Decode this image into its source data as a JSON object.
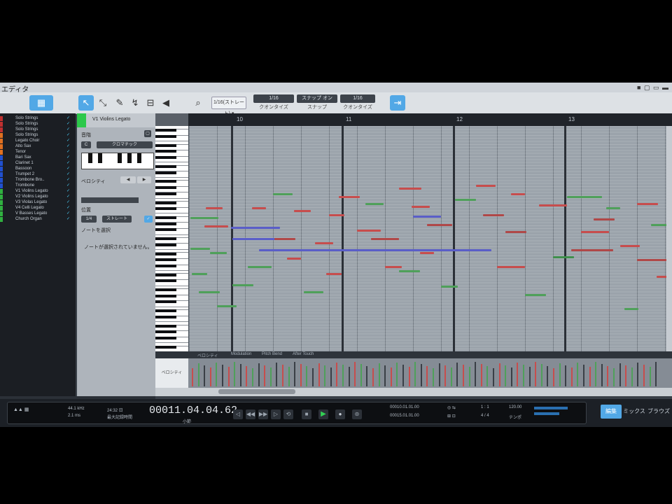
{
  "window": {
    "title": "エディタ",
    "controls": "■ ▢ ▭ ▬"
  },
  "toolbar": {
    "quantize": "1/16(ストレート) ▾",
    "boxes": [
      {
        "label": "1/16",
        "sub": "クオンタイズ"
      },
      {
        "label": "スナップ オン",
        "sub": "スナップ"
      },
      {
        "label": "1/16",
        "sub": "クオンタイズ"
      }
    ]
  },
  "tracks": [
    {
      "name": "Solo Strings",
      "color": "#c03030"
    },
    {
      "name": "Solo Strings",
      "color": "#c03030"
    },
    {
      "name": "Solo Strings",
      "color": "#c03030"
    },
    {
      "name": "Solo Strings",
      "color": "#e07020"
    },
    {
      "name": "Legato Choir",
      "color": "#e07020"
    },
    {
      "name": "Alto Sax",
      "color": "#e07020"
    },
    {
      "name": "Tenor",
      "color": "#e07020"
    },
    {
      "name": "Bari Sax",
      "color": "#2050d0"
    },
    {
      "name": "Clarinet 1",
      "color": "#2050d0"
    },
    {
      "name": "Bassoon",
      "color": "#2050d0"
    },
    {
      "name": "Trumpet 2",
      "color": "#2050d0"
    },
    {
      "name": "Trombone Bro..",
      "color": "#2050d0"
    },
    {
      "name": "Trombone",
      "color": "#2050d0"
    },
    {
      "name": "V1 Violins Legato",
      "color": "#30b040"
    },
    {
      "name": "V2 Violins Legato",
      "color": "#30b040"
    },
    {
      "name": "V3 Violas Legato",
      "color": "#30b040"
    },
    {
      "name": "V4 Celli Legato",
      "color": "#30b040"
    },
    {
      "name": "V Basses Legato",
      "color": "#30b040"
    },
    {
      "name": "Church Organ",
      "color": "#30b040"
    }
  ],
  "inspector": {
    "track_name": "V1 Violins Legato",
    "section_scale": "音階",
    "scale_button": "クロマチック",
    "label_velocity": "ベロシティ",
    "label_pos": "位置",
    "btn_a": "1/4",
    "btn_b": "ストレート",
    "label_note": "ノートを選択",
    "empty_msg": "ノートが選択されていません。"
  },
  "ruler": {
    "bars": [
      "10",
      "11",
      "12",
      "13"
    ]
  },
  "lanes": {
    "tabs": [
      "ベロシティ",
      "Modulation",
      "Pitch Bend",
      "After Touch"
    ],
    "velocity_label": "ベロシティ"
  },
  "transport": {
    "sample_rate": "44.1 kHz",
    "sample_sub": "2.1 ms",
    "record": "24:32 日",
    "record_sub": "最大記録時間",
    "time": "00011.04.04.62",
    "time_sub": "小節",
    "loop_start": "00010.01.01.00",
    "loop_end": "00015.01.01.00",
    "sync": "1 : 1",
    "tempo": "120.00",
    "sig": "4 / 4",
    "tempo_label": "テンポ"
  },
  "view_tabs": [
    "編集",
    "ミックス",
    "ブラウズ"
  ]
}
